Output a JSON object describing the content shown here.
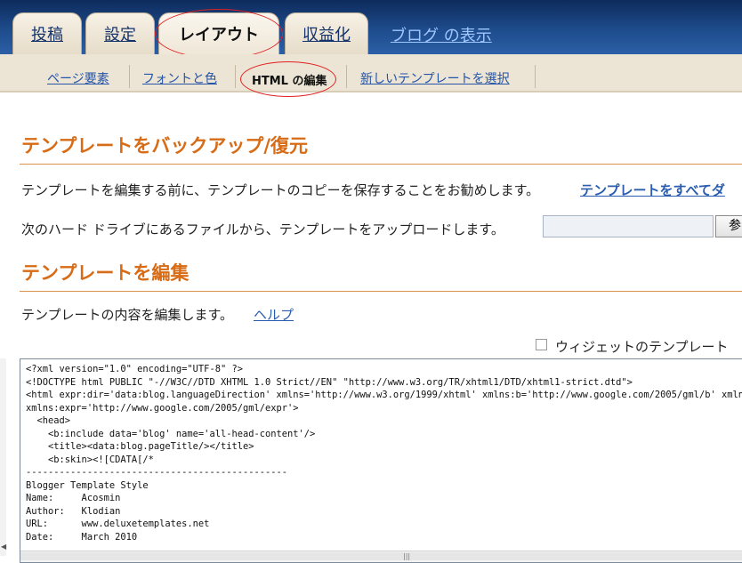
{
  "tabs": [
    {
      "label": "投稿",
      "active": false
    },
    {
      "label": "設定",
      "active": false
    },
    {
      "label": "レイアウト",
      "active": true
    },
    {
      "label": "収益化",
      "active": false
    }
  ],
  "view_blog_link": "ブログ の表示",
  "subtabs": [
    {
      "label": "ページ要素",
      "active": false
    },
    {
      "label": "フォントと色",
      "active": false
    },
    {
      "label": "HTML の編集",
      "active": true
    },
    {
      "label": "新しいテンプレートを選択",
      "active": false
    }
  ],
  "backup": {
    "heading": "テンプレートをバックアップ/復元",
    "advice": "テンプレートを編集する前に、テンプレートのコピーを保存することをお勧めします。",
    "download_link": "テンプレートをすべてダ",
    "upload_text": "次のハード ドライブにあるファイルから、テンプレートをアップロードします。",
    "file_value": "",
    "browse_label": "参"
  },
  "edit": {
    "heading": "テンプレートを編集",
    "intro": "テンプレートの内容を編集します。",
    "help_link": "ヘルプ",
    "expand_widgets_label": "ウィジェットのテンプレート",
    "expand_widgets_checked": false
  },
  "code_lines": [
    "<?xml version=\"1.0\" encoding=\"UTF-8\" ?>",
    "<!DOCTYPE html PUBLIC \"-//W3C//DTD XHTML 1.0 Strict//EN\" \"http://www.w3.org/TR/xhtml1/DTD/xhtml1-strict.dtd\">",
    "<html expr:dir='data:blog.languageDirection' xmlns='http://www.w3.org/1999/xhtml' xmlns:b='http://www.google.com/2005/gml/b' xmlns:data",
    "xmlns:expr='http://www.google.com/2005/gml/expr'>",
    "  <head>",
    "    <b:include data='blog' name='all-head-content'/>",
    "    <title><data:blog.pageTitle/></title>",
    "    <b:skin><![CDATA[/*",
    "-----------------------------------------------",
    "Blogger Template Style",
    "Name:     Acosmin",
    "Author:   Klodian",
    "URL:      www.deluxetemplates.net",
    "Date:     March 2010"
  ],
  "colors": {
    "accent": "#d76b16",
    "link": "#2a5db0",
    "header": "#1e4c8c",
    "highlight_ring": "#e02020"
  }
}
